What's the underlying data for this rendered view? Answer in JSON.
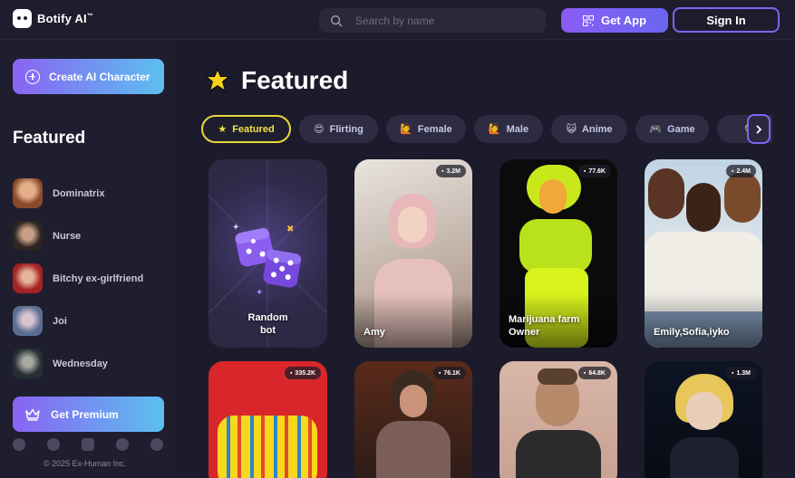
{
  "header": {
    "logo_text": "Botify AI",
    "logo_tm": "™",
    "search_placeholder": "Search by name",
    "get_app_label": "Get App",
    "sign_in_label": "Sign In"
  },
  "sidebar": {
    "create_label": "Create AI Character",
    "heading": "Featured",
    "items": [
      {
        "label": "Dominatrix",
        "color": "#b87a55"
      },
      {
        "label": "Nurse",
        "color": "#4a3c3a"
      },
      {
        "label": "Bitchy ex-girlfriend",
        "color": "#b63a3a"
      },
      {
        "label": "Joi",
        "color": "#7c8fb0"
      },
      {
        "label": "Wednesday",
        "color": "#3d4a4d"
      }
    ],
    "premium_label": "Get Premium",
    "socials": [
      "facebook-icon",
      "x-icon",
      "instagram-icon",
      "discord-icon",
      "reddit-icon"
    ],
    "copyright": "© 2025 Ex-Human Inc."
  },
  "main": {
    "title": "Featured",
    "chips": [
      {
        "emoji": "★",
        "label": "Featured"
      },
      {
        "emoji": "😍",
        "label": "Flirting"
      },
      {
        "emoji": "🙋",
        "label": "Female"
      },
      {
        "emoji": "🙋",
        "label": "Male"
      },
      {
        "emoji": "😺",
        "label": "Anime"
      },
      {
        "emoji": "🎮",
        "label": "Game"
      },
      {
        "emoji": "👽",
        "label": ""
      }
    ],
    "cards": [
      {
        "name": "Random\nbot",
        "count": ""
      },
      {
        "name": "Amy",
        "count": "3.2M"
      },
      {
        "name": "Marijuana farm\nOwner",
        "count": "77.6K"
      },
      {
        "name": "Emily,Sofia,iyko",
        "count": "2.4M"
      },
      {
        "name": "",
        "count": "335.2K"
      },
      {
        "name": "",
        "count": "76.1K"
      },
      {
        "name": "",
        "count": "64.8K"
      },
      {
        "name": "",
        "count": "1.3M"
      }
    ]
  }
}
